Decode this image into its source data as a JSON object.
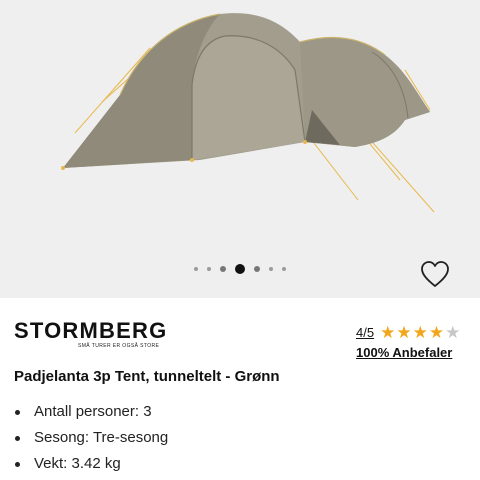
{
  "gallery": {
    "image_alt": "Padjelanta 3p Tent, tunneltelt - Grønn",
    "dot_count": 7,
    "active_index": 3,
    "favorite_icon": "heart-icon"
  },
  "brand": {
    "name": "STORMBERG",
    "tagline": "SMÅ TURER ER OGSÅ STORE"
  },
  "rating": {
    "score": "4/5",
    "stars_filled": 4,
    "stars_total": 5,
    "recommend": "100% Anbefaler",
    "star_color": "#f2a61b"
  },
  "product": {
    "title": "Padjelanta 3p Tent, tunneltelt - Grønn",
    "specs": [
      "Antall personer: 3",
      "Sesong: Tre-sesong",
      "Vekt: 3.42 kg"
    ]
  }
}
